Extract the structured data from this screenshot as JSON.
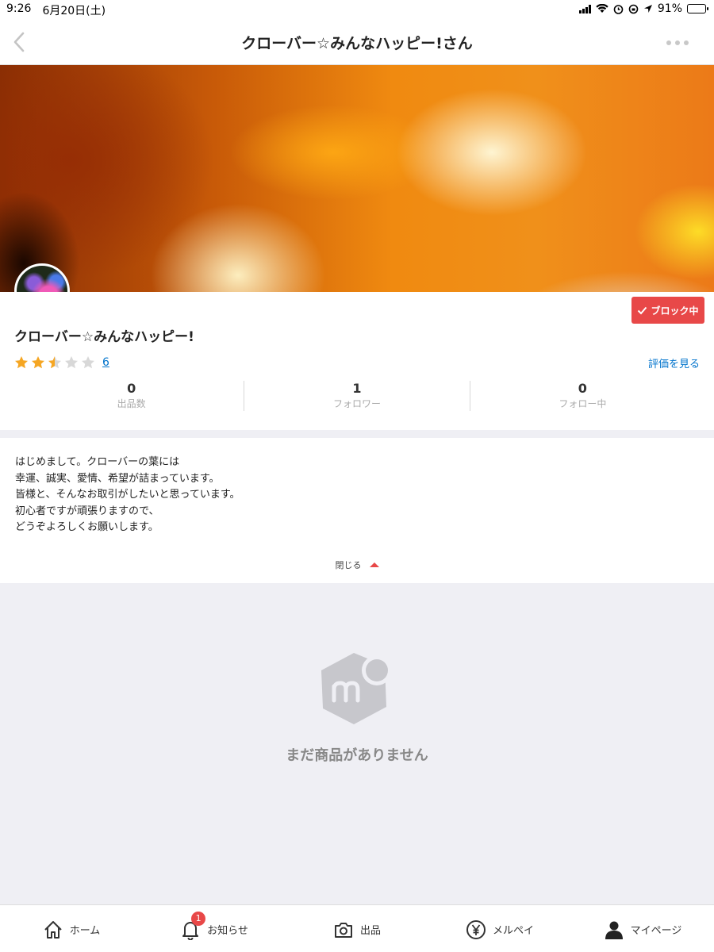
{
  "status_bar": {
    "time": "9:26",
    "date": "6月20日(土)",
    "battery": "91%",
    "battery_level": 0.91
  },
  "nav": {
    "title": "クローバー☆みんなハッピー!さん",
    "back_icon": "chevron-left-icon",
    "more_icon": "more-dots-icon"
  },
  "profile": {
    "block_label": "ブロック中",
    "name": "クローバー☆みんなハッピー!",
    "rating_stars": 2.5,
    "rating_max": 5,
    "rating_count": "6",
    "see_reviews": "評価を見る",
    "stats": [
      {
        "value": "0",
        "label": "出品数"
      },
      {
        "value": "1",
        "label": "フォロワー"
      },
      {
        "value": "0",
        "label": "フォロー中"
      }
    ]
  },
  "bio": {
    "lines": [
      "はじめまして。クローバーの葉には",
      "幸運、誠実、愛情、希望が詰まっています。",
      "皆様と、そんなお取引がしたいと思っています。",
      "初心者ですが頑張りますので、",
      "どうぞよろしくお願いします。"
    ],
    "close_label": "閉じる"
  },
  "empty": {
    "message": "まだ商品がありません"
  },
  "tabs": [
    {
      "label": "ホーム",
      "icon": "home-icon"
    },
    {
      "label": "お知らせ",
      "icon": "bell-icon",
      "badge": "1"
    },
    {
      "label": "出品",
      "icon": "camera-icon"
    },
    {
      "label": "メルペイ",
      "icon": "yen-icon"
    },
    {
      "label": "マイページ",
      "icon": "person-icon"
    }
  ],
  "colors": {
    "accent": "#e84848",
    "link": "#0073cc",
    "star": "#f5a623",
    "star_empty": "#d8d8d8"
  }
}
